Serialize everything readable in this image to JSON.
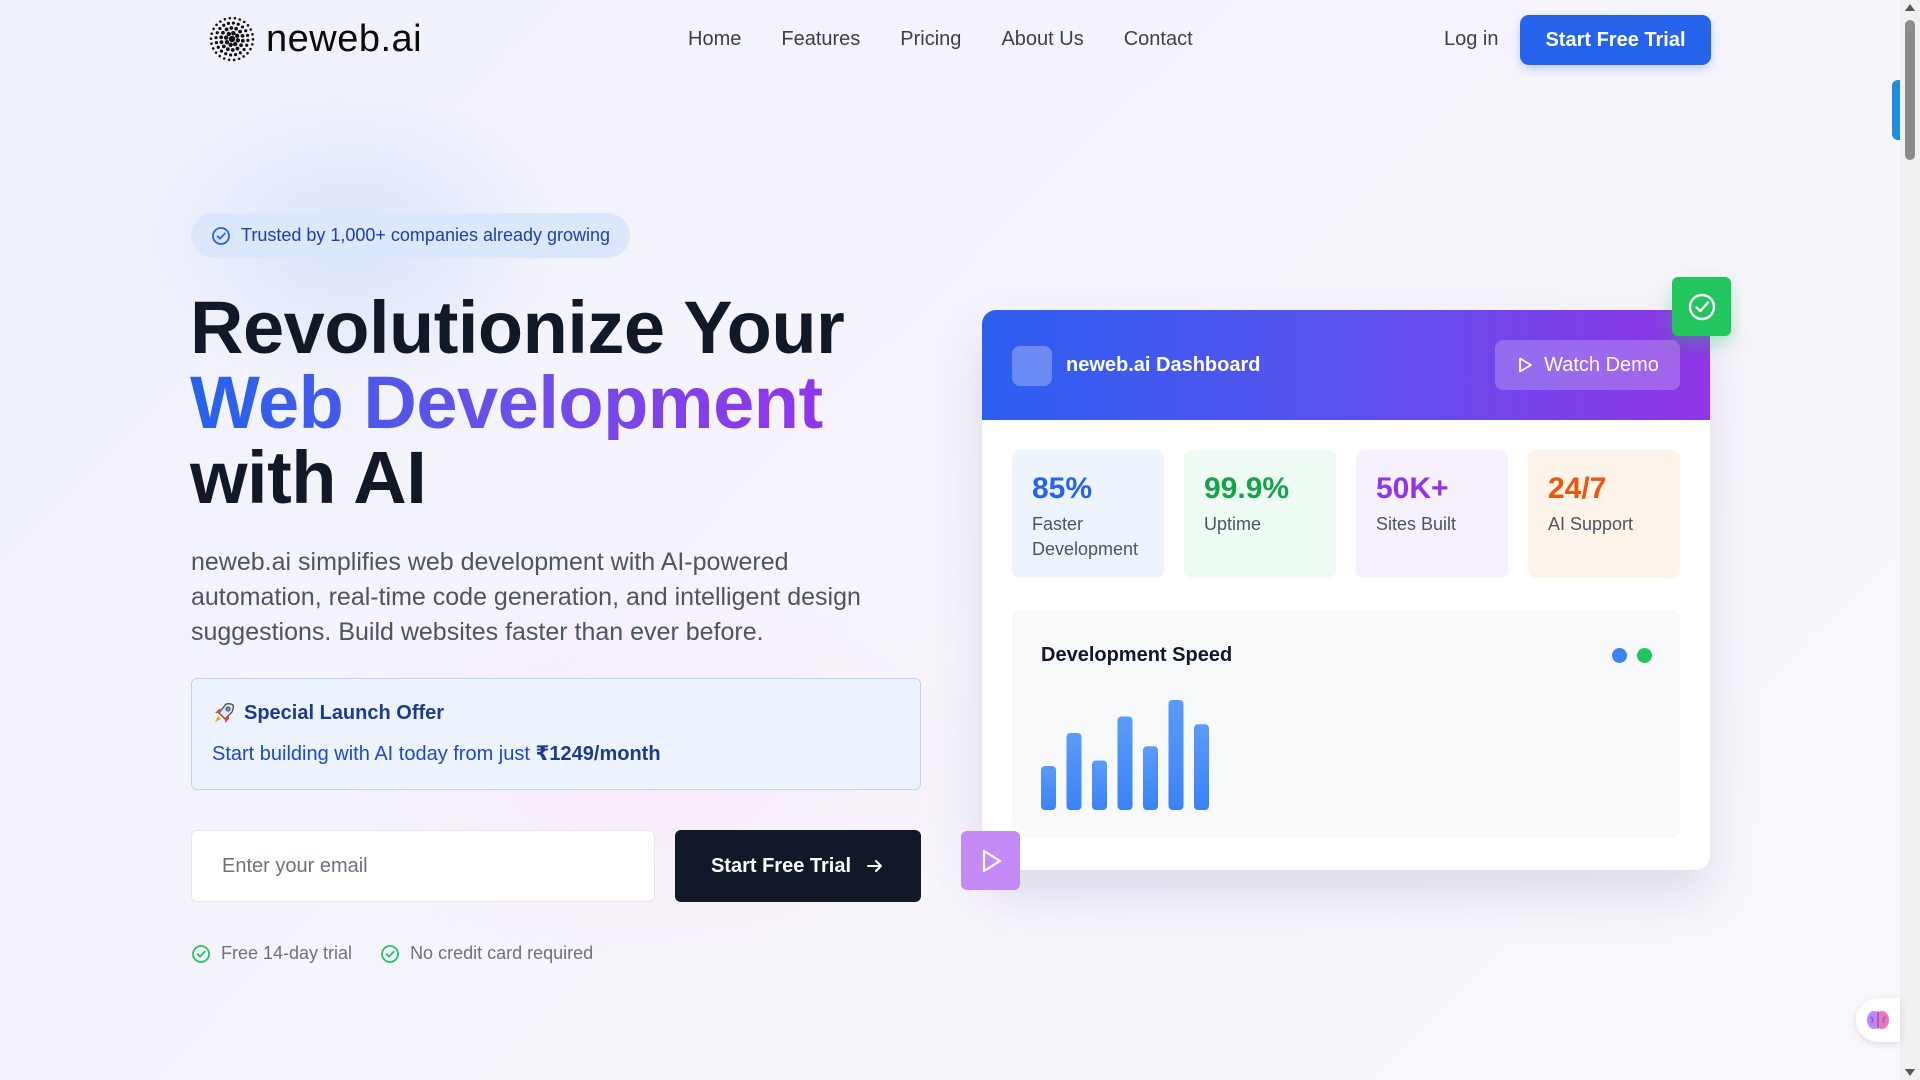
{
  "nav": {
    "logo_text": "neweb.ai",
    "links": [
      "Home",
      "Features",
      "Pricing",
      "About Us",
      "Contact"
    ],
    "login": "Log in",
    "cta": "Start Free Trial"
  },
  "hero": {
    "badge": "Trusted by 1,000+ companies already growing",
    "title_line1": "Revolutionize Your",
    "title_line2": "Web Development",
    "title_line3": "with AI",
    "description": "neweb.ai simplifies web development with AI-powered automation, real-time code generation, and intelligent design suggestions. Build websites faster than ever before.",
    "offer": {
      "icon": "rocket-icon",
      "title": "Special Launch Offer",
      "text": "Start building with AI today from just ",
      "price": "₹1249/month"
    },
    "email_placeholder": "Enter your email",
    "cta": "Start Free Trial",
    "checks": [
      "Free 14-day trial",
      "No credit card required"
    ]
  },
  "dashboard": {
    "title": "neweb.ai Dashboard",
    "watch_demo": "Watch Demo",
    "stats": [
      {
        "value": "85%",
        "label": "Faster Development",
        "color": "#2563eb",
        "bg": "#eef4fd"
      },
      {
        "value": "99.9%",
        "label": "Uptime",
        "color": "#16a34a",
        "bg": "#eefcf3"
      },
      {
        "value": "50K+",
        "label": "Sites Built",
        "color": "#9333ea",
        "bg": "#f7f1fd"
      },
      {
        "value": "24/7",
        "label": "AI Support",
        "color": "#ea580c",
        "bg": "#fff4ea"
      }
    ],
    "chart": {
      "title": "Development Speed",
      "legend_colors": [
        "#3b82f6",
        "#22c55e"
      ]
    }
  },
  "chart_data": {
    "type": "bar",
    "title": "Development Speed",
    "values": [
      40,
      70,
      45,
      85,
      58,
      100,
      78
    ],
    "ylim": [
      0,
      100
    ],
    "color": "#3b82f6"
  },
  "colors": {
    "primary": "#2563eb",
    "dark": "#111827",
    "success": "#22c55e",
    "purple": "#9333ea"
  }
}
